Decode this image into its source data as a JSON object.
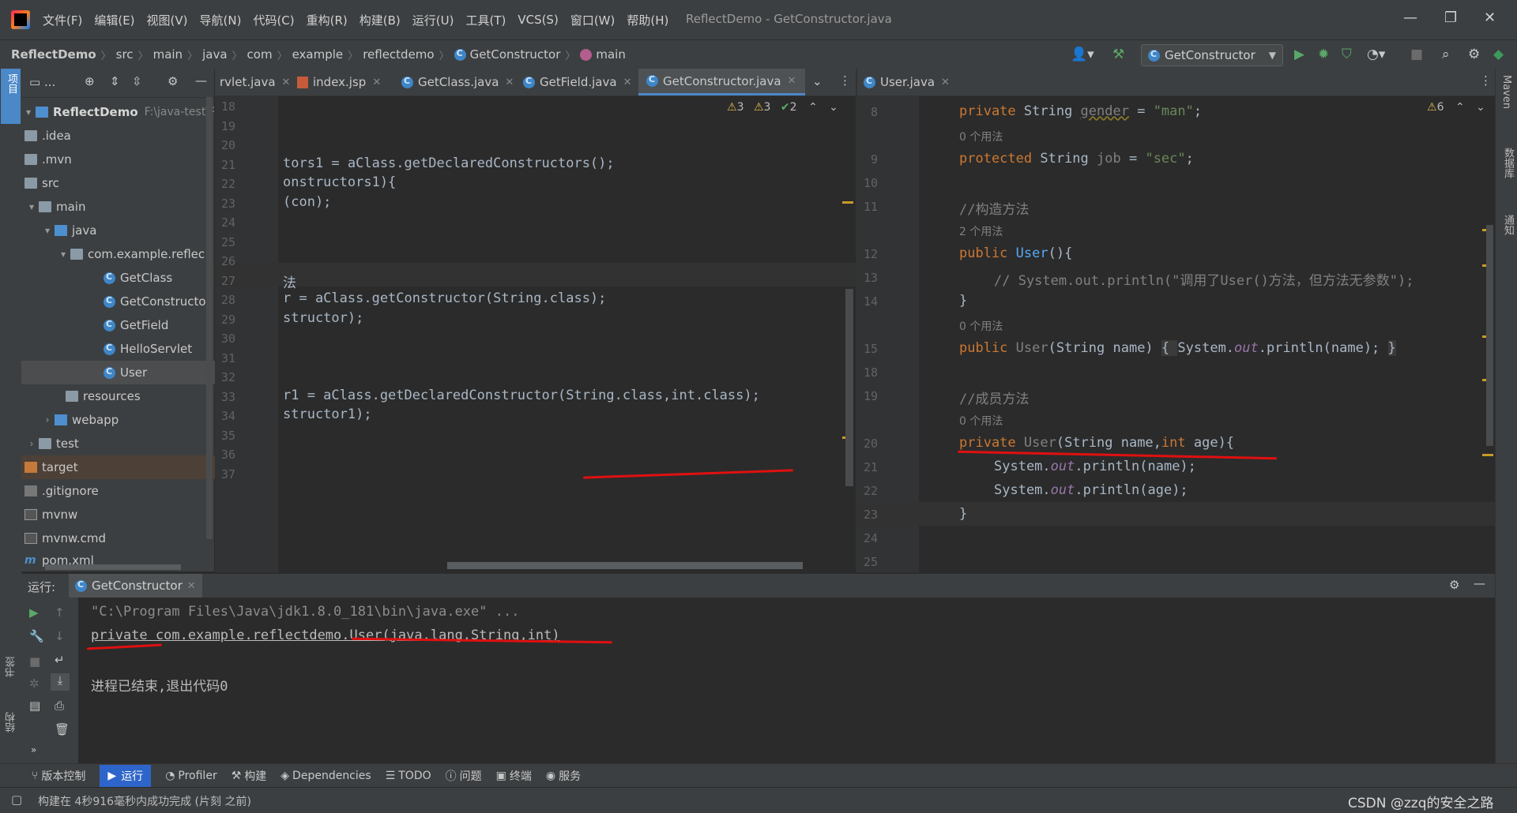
{
  "window": {
    "title": "ReflectDemo - GetConstructor.java",
    "menu": [
      "文件(F)",
      "编辑(E)",
      "视图(V)",
      "导航(N)",
      "代码(C)",
      "重构(R)",
      "构建(B)",
      "运行(U)",
      "工具(T)",
      "VCS(S)",
      "窗口(W)",
      "帮助(H)"
    ]
  },
  "breadcrumb": [
    "ReflectDemo",
    "src",
    "main",
    "java",
    "com",
    "example",
    "reflectdemo",
    "GetConstructor",
    "main"
  ],
  "toolbar": {
    "run_config": "GetConstructor"
  },
  "project": {
    "root_name": "ReflectDemo",
    "root_path": "F:\\java-test\\Reflec",
    "items": [
      {
        "label": ".idea"
      },
      {
        "label": ".mvn"
      },
      {
        "label": "src"
      },
      {
        "label": "main"
      },
      {
        "label": "java"
      },
      {
        "label": "com.example.reflec"
      },
      {
        "label": "GetClass"
      },
      {
        "label": "GetConstructor"
      },
      {
        "label": "GetField"
      },
      {
        "label": "HelloServlet"
      },
      {
        "label": "User"
      },
      {
        "label": "resources"
      },
      {
        "label": "webapp"
      },
      {
        "label": "test"
      },
      {
        "label": "target"
      },
      {
        "label": ".gitignore"
      },
      {
        "label": "mvnw"
      },
      {
        "label": "mvnw.cmd"
      },
      {
        "label": "pom.xml"
      }
    ]
  },
  "left_editor": {
    "tabs": [
      "rvlet.java",
      "index.jsp",
      "GetClass.java",
      "GetField.java",
      "GetConstructor.java"
    ],
    "inspections": {
      "warn1": "3",
      "warn2": "3",
      "typo": "2"
    },
    "lines": [
      {
        "n": "18",
        "code": ""
      },
      {
        "n": "19",
        "code": ""
      },
      {
        "n": "20",
        "code": ""
      },
      {
        "n": "21",
        "code": "tors1 = aClass.getDeclaredConstructors();"
      },
      {
        "n": "22",
        "code": "onstructors1){"
      },
      {
        "n": "23",
        "code": "(con);"
      },
      {
        "n": "24",
        "code": ""
      },
      {
        "n": "25",
        "code": ""
      },
      {
        "n": "26",
        "code": ""
      },
      {
        "n": "27",
        "code": "法"
      },
      {
        "n": "28",
        "code": "r = aClass.getConstructor(String.class);"
      },
      {
        "n": "29",
        "code": "structor);"
      },
      {
        "n": "30",
        "code": ""
      },
      {
        "n": "31",
        "code": ""
      },
      {
        "n": "32",
        "code": ""
      },
      {
        "n": "33",
        "code": "r1 = aClass.getDeclaredConstructor(String.class,int.class);"
      },
      {
        "n": "34",
        "code": "structor1);"
      },
      {
        "n": "35",
        "code": ""
      },
      {
        "n": "36",
        "code": ""
      },
      {
        "n": "37",
        "code": ""
      }
    ]
  },
  "right_editor": {
    "tab": "User.java",
    "inspections": {
      "warn": "6"
    },
    "line_numbers": [
      "8",
      "9",
      "10",
      "11",
      "12",
      "13",
      "14",
      "15",
      "18",
      "19",
      "20",
      "21",
      "22",
      "23",
      "24",
      "25"
    ],
    "usages": {
      "zero": "0 个用法",
      "two": "2 个用法"
    },
    "code": {
      "l8": "private String gender = \"man\";",
      "l9": "protected String job = \"sec\";",
      "l11": "//构造方法",
      "l12": "public User(){",
      "l13": "// System.out.println(\"调用了User()方法，但方法无参数\");",
      "l14": "}",
      "l15": "public User(String name) { System.out.println(name); }",
      "l19": "//成员方法",
      "l20": "private User(String name,int age){",
      "l21": "System.out.println(name);",
      "l22": "System.out.println(age);",
      "l23": "}"
    }
  },
  "run_panel": {
    "label": "运行:",
    "tab": "GetConstructor",
    "output": [
      "\"C:\\Program Files\\Java\\jdk1.8.0_181\\bin\\java.exe\" ...",
      "private com.example.reflectdemo.User(java.lang.String,int)",
      "",
      "进程已结束,退出代码0"
    ]
  },
  "side_labels": {
    "project": "项目",
    "bookmarks": "书签",
    "structure": "结构",
    "maven": "Maven",
    "database": "数据库",
    "notifications": "通知"
  },
  "bottom_tools": [
    "版本控制",
    "运行",
    "Profiler",
    "构建",
    "Dependencies",
    "TODO",
    "问题",
    "终端",
    "服务"
  ],
  "status": {
    "message": "构建在 4秒916毫秒内成功完成 (片刻 之前)",
    "watermark": "CSDN @zzq的安全之路"
  }
}
